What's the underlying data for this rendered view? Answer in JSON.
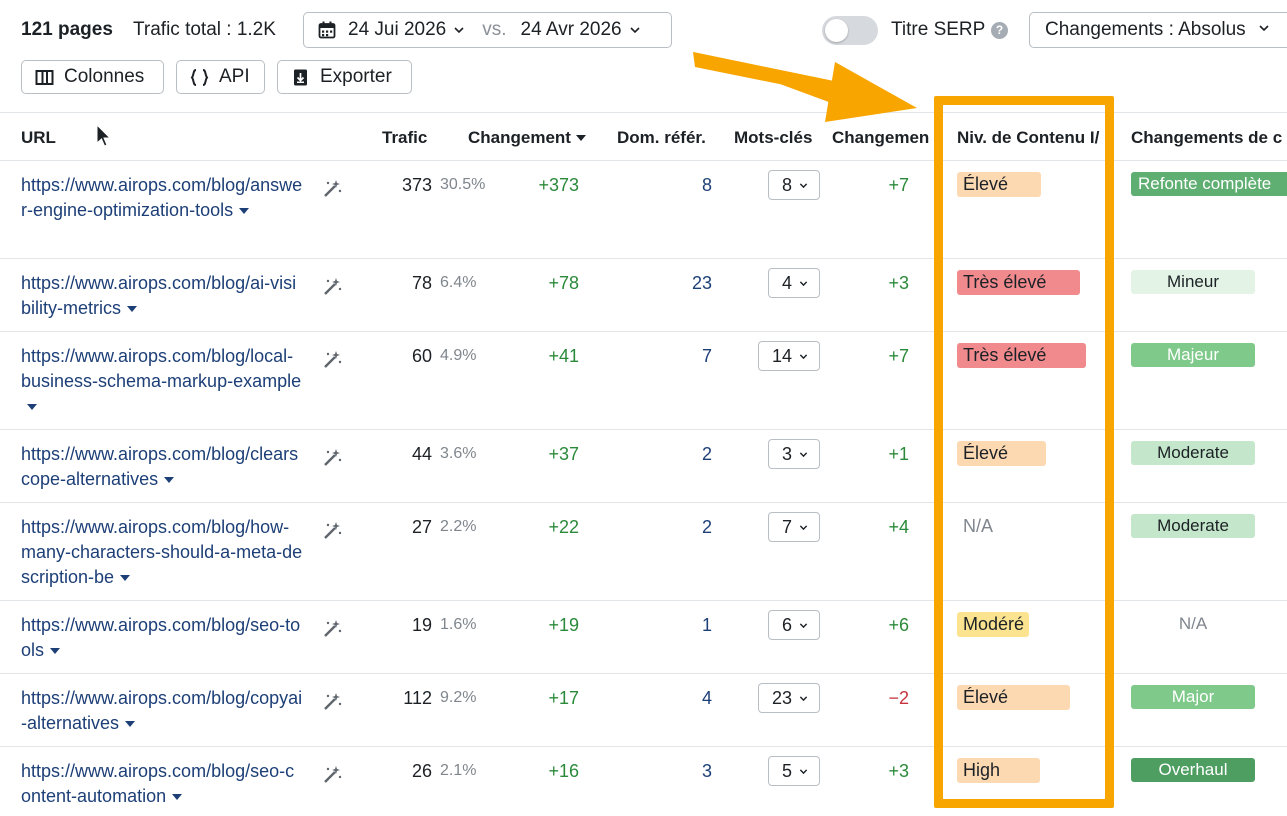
{
  "toolbar": {
    "pages_count": "121 pages",
    "traffic_total": "Trafic total : 1.2K",
    "date_current": "24 Jui 2026",
    "vs_label": "vs.",
    "date_compare": "24 Avr 2026",
    "serp_toggle_label": "Titre SERP",
    "serp_toggle_on": false,
    "help_glyph": "?",
    "changes_select_value": "Changements : Absolus",
    "columns_button": "Colonnes",
    "api_button": "API",
    "export_button": "Exporter"
  },
  "table": {
    "headers": {
      "url": "URL",
      "traffic": "Trafic",
      "change": "Changement",
      "ref_domains": "Dom. référ.",
      "keywords": "Mots-clés",
      "kw_change": "Changemen",
      "content_level": "Niv. de Contenu I/",
      "content_changes": "Changements de c"
    },
    "rows": [
      {
        "url": "https://www.airops.com/blog/answer-engine-optimization-tools",
        "traffic": "373",
        "pct": "30.5%",
        "change": "+373",
        "ref_domains": "8",
        "keywords": "8",
        "kw_change": "+7",
        "level": "Élevé",
        "content_change": "Refonte complète"
      },
      {
        "url": "https://www.airops.com/blog/ai-visibility-metrics",
        "traffic": "78",
        "pct": "6.4%",
        "change": "+78",
        "ref_domains": "23",
        "keywords": "4",
        "kw_change": "+3",
        "level": "Très élevé",
        "content_change": "Mineur"
      },
      {
        "url": "https://www.airops.com/blog/local-business-schema-markup-example",
        "traffic": "60",
        "pct": "4.9%",
        "change": "+41",
        "ref_domains": "7",
        "keywords": "14",
        "kw_change": "+7",
        "level": "Très élevé",
        "content_change": "Majeur"
      },
      {
        "url": "https://www.airops.com/blog/clearscope-alternatives",
        "traffic": "44",
        "pct": "3.6%",
        "change": "+37",
        "ref_domains": "2",
        "keywords": "3",
        "kw_change": "+1",
        "level": "Élevé",
        "content_change": "Moderate"
      },
      {
        "url": "https://www.airops.com/blog/how-many-characters-should-a-meta-description-be",
        "traffic": "27",
        "pct": "2.2%",
        "change": "+22",
        "ref_domains": "2",
        "keywords": "7",
        "kw_change": "+4",
        "level": "N/A",
        "content_change": "Moderate"
      },
      {
        "url": "https://www.airops.com/blog/seo-tools",
        "traffic": "19",
        "pct": "1.6%",
        "change": "+19",
        "ref_domains": "1",
        "keywords": "6",
        "kw_change": "+6",
        "level": "Modéré",
        "content_change": "N/A"
      },
      {
        "url": "https://www.airops.com/blog/copyai-alternatives",
        "traffic": "112",
        "pct": "9.2%",
        "change": "+17",
        "ref_domains": "4",
        "keywords": "23",
        "kw_change": "−2",
        "level": "Élevé",
        "content_change": "Major"
      },
      {
        "url": "https://www.airops.com/blog/seo-content-automation",
        "traffic": "26",
        "pct": "2.1%",
        "change": "+16",
        "ref_domains": "3",
        "keywords": "5",
        "kw_change": "+3",
        "level": "High",
        "content_change": "Overhaul"
      }
    ]
  },
  "colors": {
    "link": "#1d3f77",
    "positive": "#2b8a3a",
    "negative": "#c6343e",
    "highlight": "#f8a500",
    "level_eleve": "#fdd9b2",
    "level_tres_eleve": "#f08a8d",
    "level_modere": "#fbe38f",
    "change_major": "#7fc98a",
    "change_minor": "#e3f4e6",
    "change_moderate": "#c4e6ca",
    "change_overhaul": "#4e9e62"
  },
  "icons": {
    "calendar": "calendar-icon",
    "columns": "columns-icon",
    "api": "braces-icon",
    "export": "download-icon",
    "wand": "magic-wand-icon",
    "cursor": "mouse-pointer-icon",
    "annotation_arrow": "arrow-annotation-icon"
  }
}
